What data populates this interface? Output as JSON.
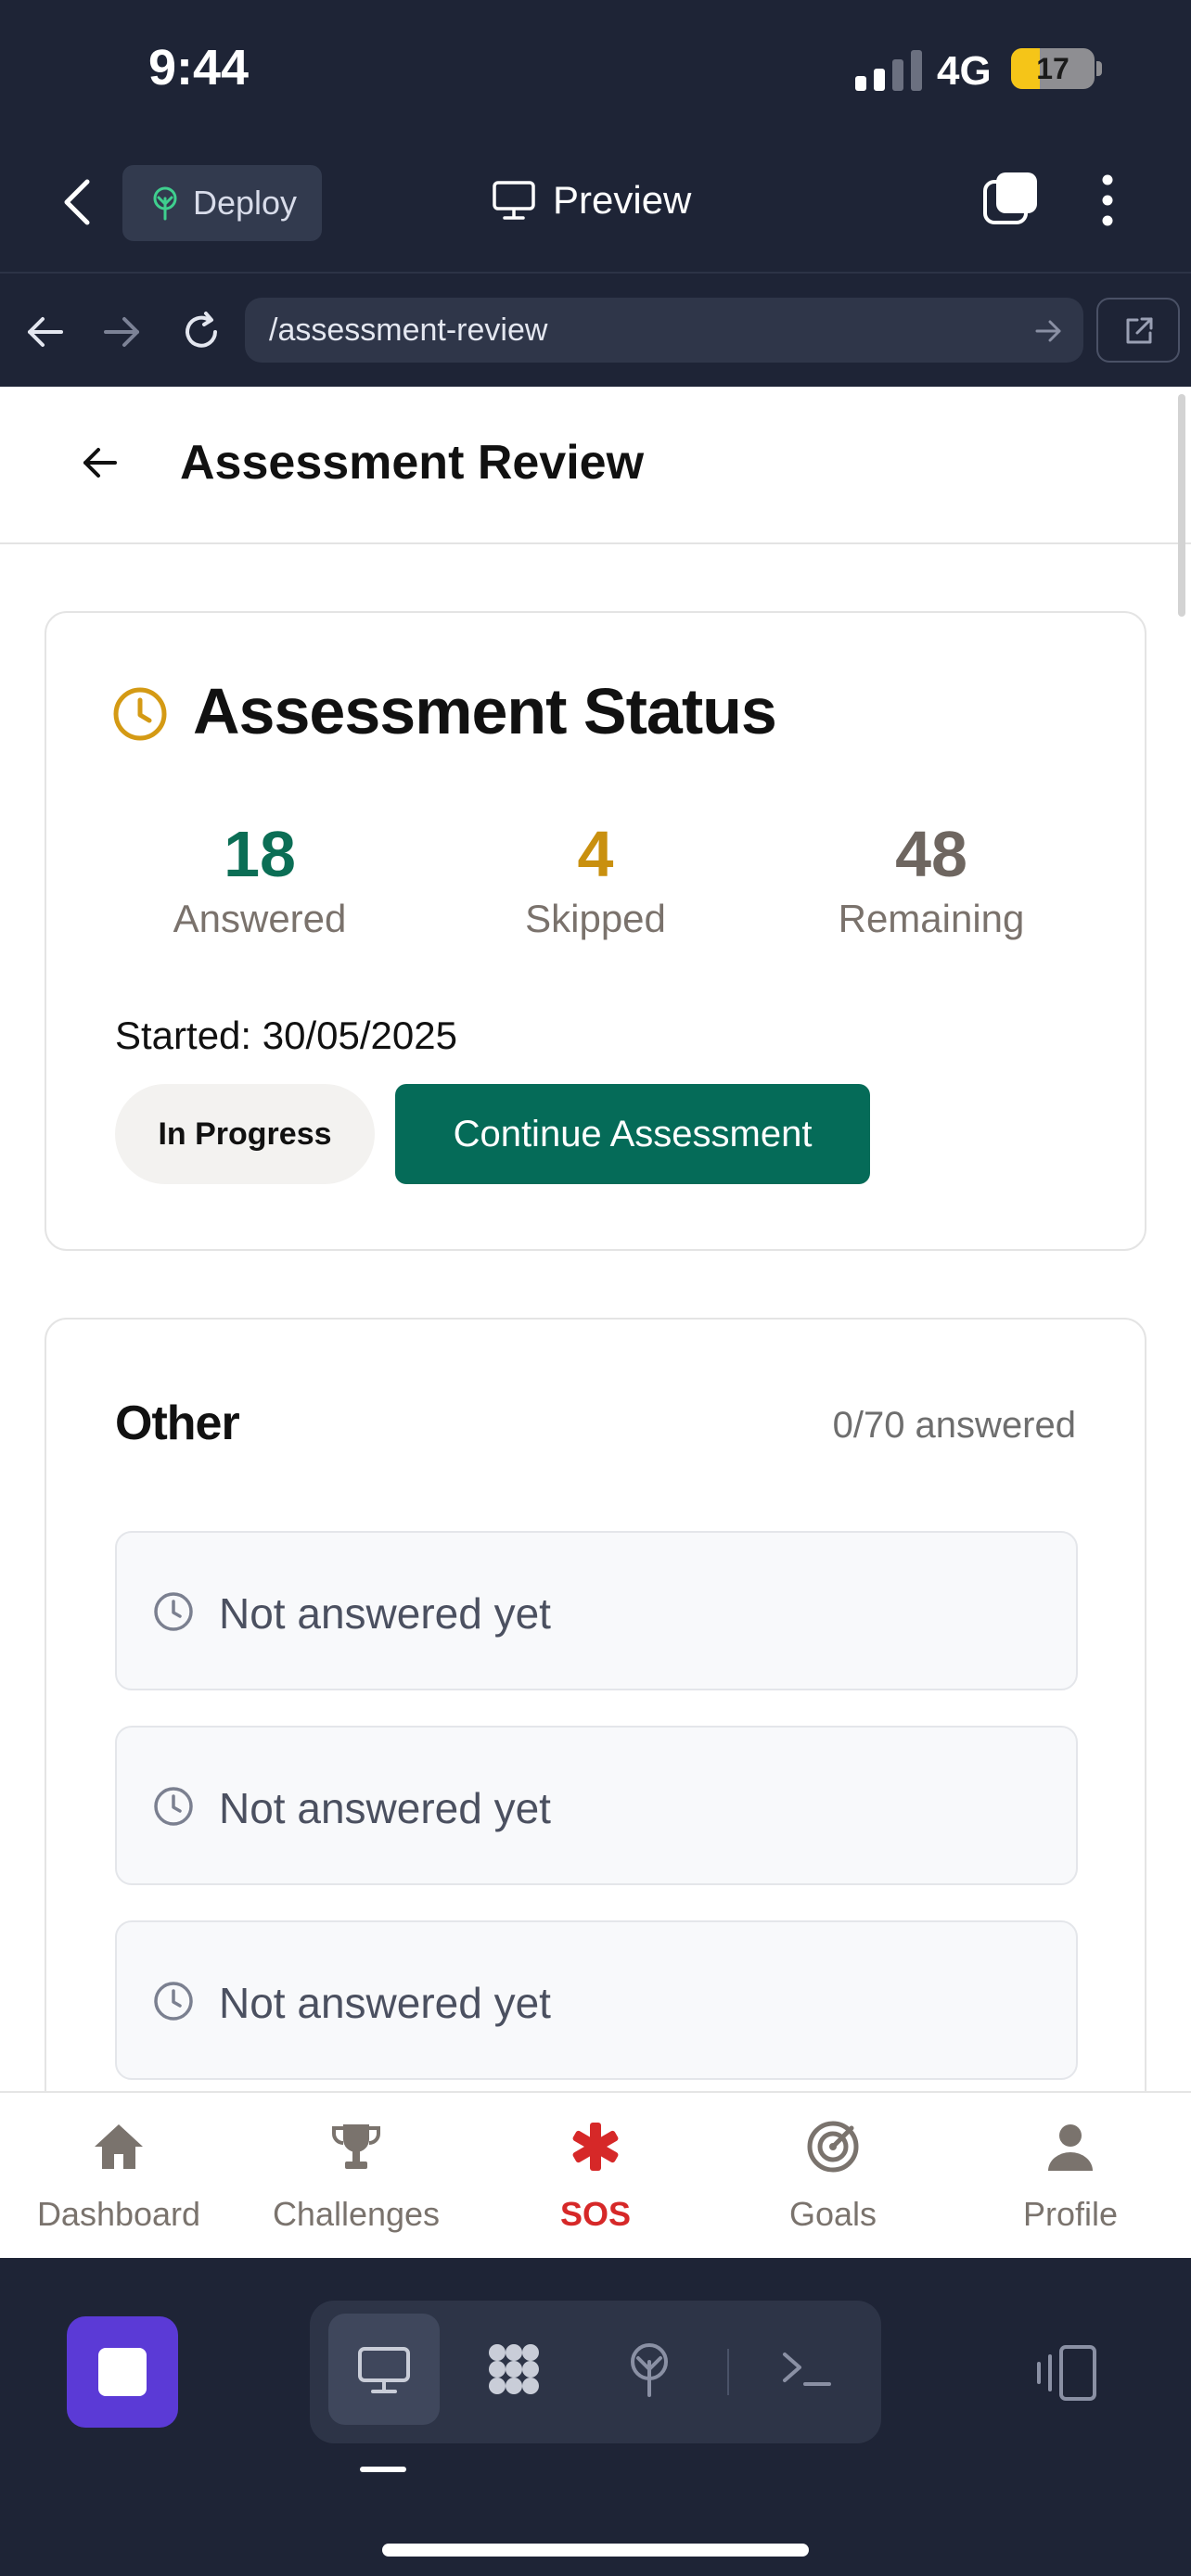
{
  "status_bar": {
    "time": "9:44",
    "network": "4G",
    "battery_level": "17",
    "battery_fraction": 0.17,
    "signal_bars": 2,
    "signal_bars_total": 4
  },
  "top_bar": {
    "deploy_label": "Deploy",
    "preview_label": "Preview",
    "icons": [
      "chevron-left-icon",
      "deploy-icon",
      "monitor-icon",
      "tabs-icon",
      "more-vertical-icon"
    ]
  },
  "url_bar": {
    "url": "/assessment-review"
  },
  "page": {
    "title": "Assessment Review"
  },
  "status_card": {
    "title": "Assessment Status",
    "stats": [
      {
        "value": "18",
        "label": "Answered",
        "color": "#0b6e55"
      },
      {
        "value": "4",
        "label": "Skipped",
        "color": "#c9900f"
      },
      {
        "value": "48",
        "label": "Remaining",
        "color": "#6e6660"
      }
    ],
    "started": "Started: 30/05/2025",
    "badge": "In Progress",
    "continue_label": "Continue Assessment"
  },
  "other_section": {
    "title": "Other",
    "count": "0/70 answered",
    "items": [
      {
        "label": "Not answered yet"
      },
      {
        "label": "Not answered yet"
      },
      {
        "label": "Not answered yet"
      }
    ]
  },
  "bottom_nav": {
    "items": [
      {
        "label": "Dashboard",
        "icon": "home-icon"
      },
      {
        "label": "Challenges",
        "icon": "trophy-icon"
      },
      {
        "label": "SOS",
        "icon": "asterisk-icon",
        "active": true
      },
      {
        "label": "Goals",
        "icon": "target-icon"
      },
      {
        "label": "Profile",
        "icon": "user-icon"
      }
    ]
  },
  "colors": {
    "app_chrome": "#1e2436",
    "primary_green": "#056b58",
    "sos_red": "#d62828",
    "clock_amber": "#d49a14",
    "stop_purple": "#5b3ad6"
  }
}
